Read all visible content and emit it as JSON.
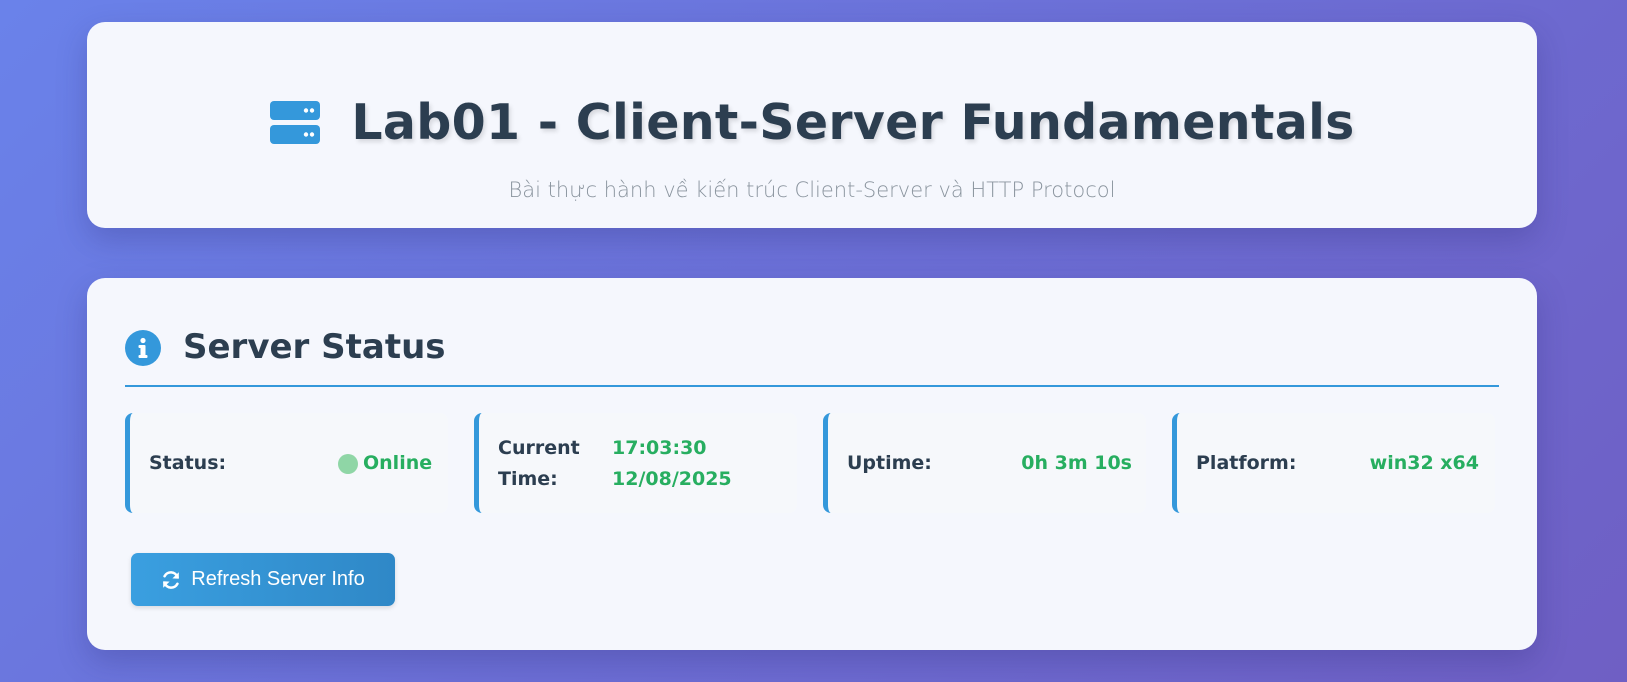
{
  "header": {
    "icon": "server-icon",
    "title": "Lab01 - Client-Server Fundamentals",
    "subtitle": "Bài thực hành về kiến trúc Client-Server và HTTP Protocol"
  },
  "status_section": {
    "icon": "info-circle-icon",
    "title": "Server Status",
    "items": [
      {
        "label": "Status:",
        "value": "Online",
        "status_color": "#27ae60"
      },
      {
        "label_line1": "Current",
        "label_line2": "Time:",
        "value_line1": "17:03:30",
        "value_line2": "12/08/2025"
      },
      {
        "label": "Uptime:",
        "value": "0h 3m 10s"
      },
      {
        "label": "Platform:",
        "value": "win32 x64"
      }
    ],
    "refresh_button": {
      "icon": "refresh-icon",
      "label": "Refresh Server Info"
    }
  },
  "colors": {
    "accent": "#3498db",
    "value_green": "#27ae60",
    "heading": "#2c3e50",
    "background_start": "#6a82ea",
    "background_end": "#6f5fc4"
  }
}
